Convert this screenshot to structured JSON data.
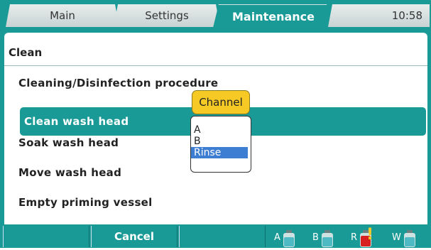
{
  "tabs": [
    {
      "label": "Main",
      "active": false
    },
    {
      "label": "Settings",
      "active": false
    },
    {
      "label": "Maintenance",
      "active": true
    }
  ],
  "clock": "10:58",
  "panel": {
    "title": "Clean",
    "items": [
      {
        "label": "Cleaning/Disinfection procedure",
        "selected": false
      },
      {
        "label": "Clean wash head",
        "selected": true
      },
      {
        "label": "Soak wash head",
        "selected": false
      },
      {
        "label": "Move wash head",
        "selected": false
      },
      {
        "label": "Empty priming vessel",
        "selected": false
      }
    ]
  },
  "popup": {
    "title": "Channel",
    "options": [
      "A",
      "B",
      "Rinse"
    ],
    "selected": "Rinse"
  },
  "softkeys": [
    "",
    "Cancel",
    ""
  ],
  "bottles": [
    {
      "label": "A",
      "color": "#4fb9c4",
      "warning": false
    },
    {
      "label": "B",
      "color": "#4fb9c4",
      "warning": false
    },
    {
      "label": "R",
      "color": "#d82020",
      "warning": true
    },
    {
      "label": "W",
      "color": "#4fb9c4",
      "warning": false
    }
  ],
  "colors": {
    "accent": "#1a9a96",
    "highlight": "#3d7ed2",
    "popup_title": "#f6c925"
  }
}
